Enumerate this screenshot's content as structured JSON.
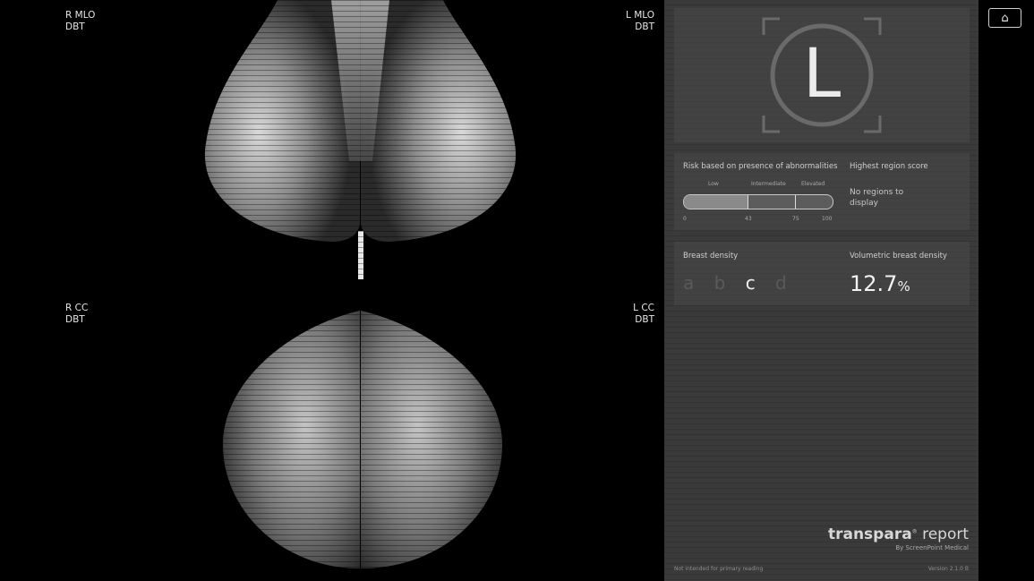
{
  "views": {
    "r_mlo": {
      "line1": "R MLO",
      "line2": "DBT"
    },
    "l_mlo": {
      "line1": "L MLO",
      "line2": "DBT"
    },
    "r_cc": {
      "line1": "R CC",
      "line2": "DBT"
    },
    "l_cc": {
      "line1": "L CC",
      "line2": "DBT"
    }
  },
  "laterality": {
    "letter": "L"
  },
  "risk": {
    "title": "Risk based on presence of abnormalities",
    "zones": [
      "Low",
      "Intermediate",
      "Elevated"
    ],
    "ticks": [
      "0",
      "43",
      "75",
      "100"
    ],
    "score_fraction": 0.43
  },
  "region": {
    "title": "Highest region score",
    "empty_text": "No regions to display"
  },
  "density": {
    "title": "Breast density",
    "letters": [
      "a",
      "b",
      "c",
      "d"
    ],
    "active": "c"
  },
  "volumetric": {
    "title": "Volumetric breast density",
    "value": "12.7",
    "unit": "%"
  },
  "brand": {
    "name_bold": "transpara",
    "reg": "®",
    "name_light": " report",
    "byline": "By ScreenPoint Medical"
  },
  "footer": {
    "disclaimer": "Not intended for primary reading",
    "version": "Version 2.1.0  B"
  },
  "home": {
    "icon": "home-icon",
    "glyph": "⌂"
  },
  "colors": {
    "panel_bg": "#3a3a3a",
    "card_bg": "#484848",
    "text": "#dddddd"
  }
}
